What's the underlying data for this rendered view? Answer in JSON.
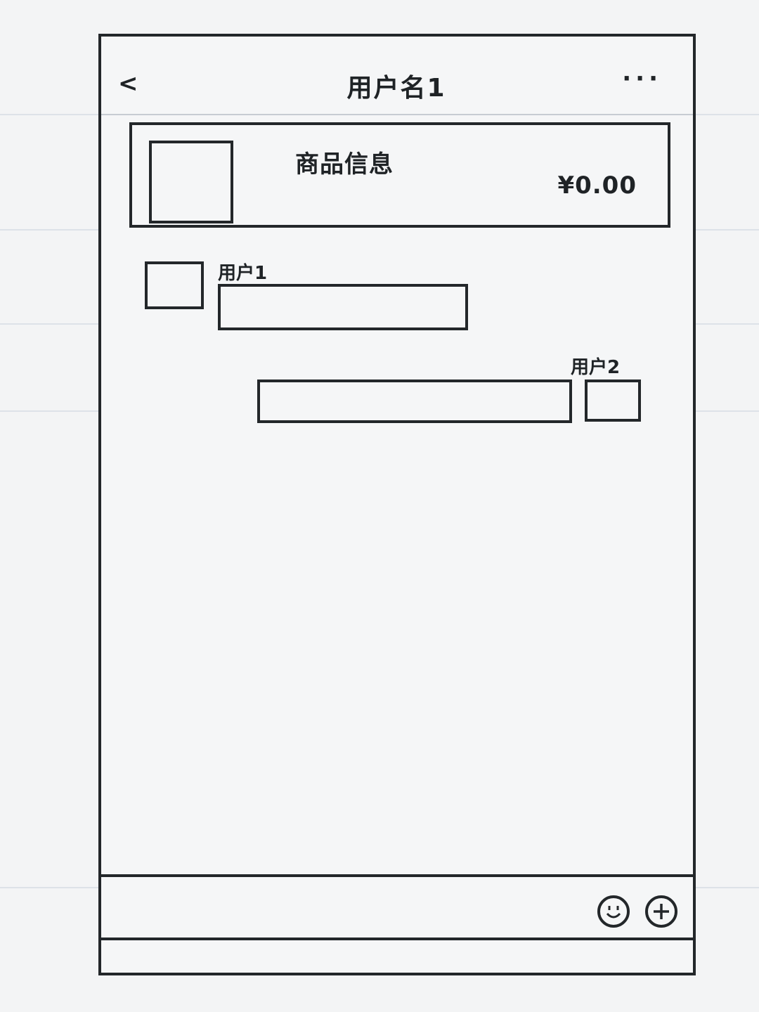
{
  "header": {
    "back_glyph": "<",
    "title": "用户名1",
    "more_glyph": "···"
  },
  "product": {
    "info": "商品信息",
    "price": "¥0.00"
  },
  "messages": [
    {
      "sender": "用户1",
      "side": "left"
    },
    {
      "sender": "用户2",
      "side": "right"
    }
  ],
  "input_bar": {
    "icons": [
      "emoji-icon",
      "plus-icon"
    ]
  }
}
